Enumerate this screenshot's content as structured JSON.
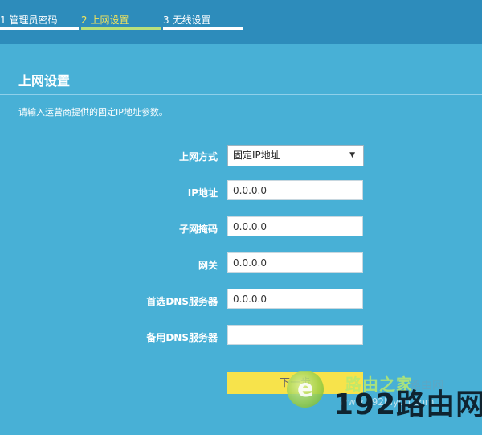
{
  "steps": [
    {
      "label": "1 管理员密码",
      "active": false
    },
    {
      "label": "2 上网设置",
      "active": true
    },
    {
      "label": "3 无线设置",
      "active": false
    }
  ],
  "section": {
    "title": "上网设置",
    "hint": "请输入运营商提供的固定IP地址参数。"
  },
  "form": {
    "connection_type": {
      "label": "上网方式",
      "value": "固定IP地址"
    },
    "ip": {
      "label": "IP地址",
      "value": "0.0.0.0"
    },
    "mask": {
      "label": "子网掩码",
      "value": "0.0.0.0"
    },
    "gateway": {
      "label": "网关",
      "value": "0.0.0.0"
    },
    "dns1": {
      "label": "首选DNS服务器",
      "value": "0.0.0.0"
    },
    "dns2": {
      "label": "备用DNS服务器",
      "value": ""
    }
  },
  "next_button": {
    "label": "下一步"
  },
  "watermark": {
    "top_text": "路由之家",
    "ghost_text": "路由网",
    "url": "www.192luyou.com",
    "big_text": "192路由网"
  },
  "colors": {
    "background": "#48b0d6",
    "topbar": "#2d8cbb",
    "active_step_text": "#f4e55a",
    "active_step_line": "#b8e07c",
    "button": "#f7e34b"
  }
}
